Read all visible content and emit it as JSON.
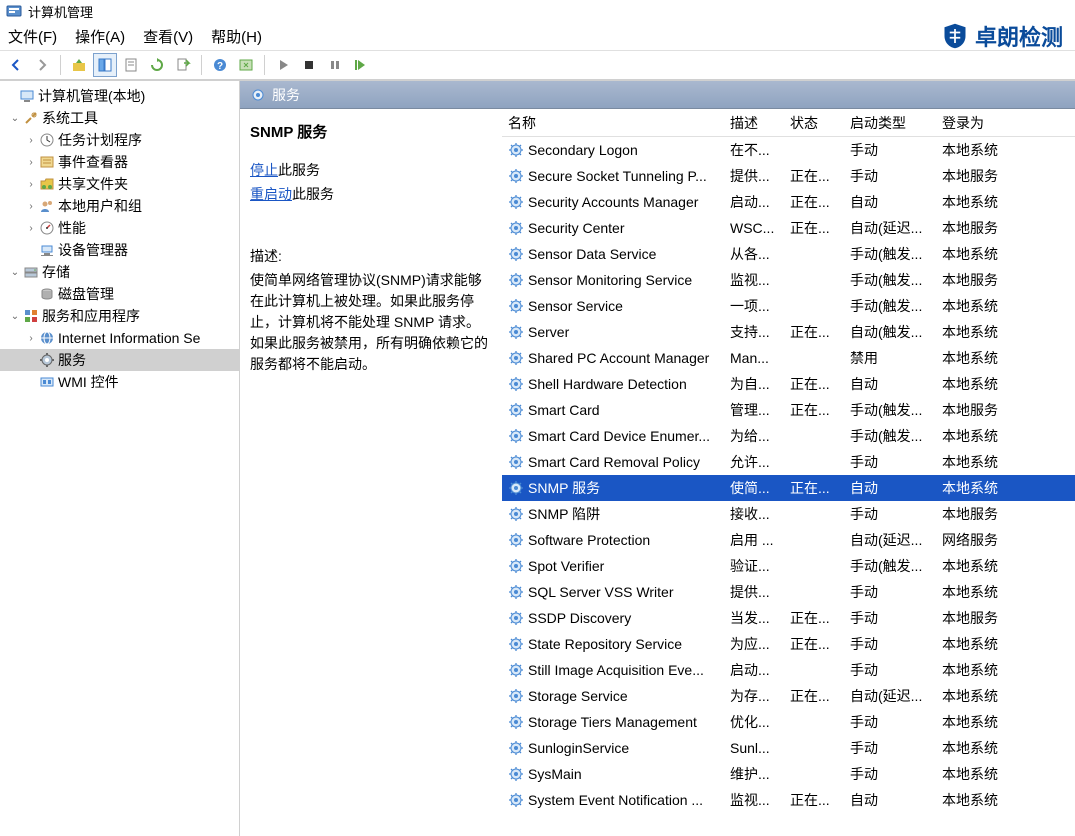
{
  "window_title": "计算机管理",
  "menu": {
    "file": "文件(F)",
    "action": "操作(A)",
    "view": "查看(V)",
    "help": "帮助(H)"
  },
  "brand": "卓朗检测",
  "tree": {
    "root": "计算机管理(本地)",
    "system_tools": "系统工具",
    "task_scheduler": "任务计划程序",
    "event_viewer": "事件查看器",
    "shared_folders": "共享文件夹",
    "local_users": "本地用户和组",
    "performance": "性能",
    "device_manager": "设备管理器",
    "storage": "存储",
    "disk_management": "磁盘管理",
    "services_apps": "服务和应用程序",
    "iis": "Internet Information Se",
    "services": "服务",
    "wmi": "WMI 控件"
  },
  "content_header": "服务",
  "detail": {
    "title": "SNMP 服务",
    "stop_link": "停止",
    "stop_suffix": "此服务",
    "restart_link": "重启动",
    "restart_suffix": "此服务",
    "desc_label": "描述:",
    "desc_text": "使简单网络管理协议(SNMP)请求能够在此计算机上被处理。如果此服务停止，计算机将不能处理 SNMP 请求。如果此服务被禁用，所有明确依赖它的服务都将不能启动。"
  },
  "columns": {
    "name": "名称",
    "desc": "描述",
    "status": "状态",
    "startup": "启动类型",
    "logon": "登录为"
  },
  "services": [
    {
      "name": "Secondary Logon",
      "desc": "在不...",
      "status": "",
      "startup": "手动",
      "logon": "本地系统"
    },
    {
      "name": "Secure Socket Tunneling P...",
      "desc": "提供...",
      "status": "正在...",
      "startup": "手动",
      "logon": "本地服务"
    },
    {
      "name": "Security Accounts Manager",
      "desc": "启动...",
      "status": "正在...",
      "startup": "自动",
      "logon": "本地系统"
    },
    {
      "name": "Security Center",
      "desc": "WSC...",
      "status": "正在...",
      "startup": "自动(延迟...",
      "logon": "本地服务"
    },
    {
      "name": "Sensor Data Service",
      "desc": "从各...",
      "status": "",
      "startup": "手动(触发...",
      "logon": "本地系统"
    },
    {
      "name": "Sensor Monitoring Service",
      "desc": "监视...",
      "status": "",
      "startup": "手动(触发...",
      "logon": "本地服务"
    },
    {
      "name": "Sensor Service",
      "desc": "一项...",
      "status": "",
      "startup": "手动(触发...",
      "logon": "本地系统"
    },
    {
      "name": "Server",
      "desc": "支持...",
      "status": "正在...",
      "startup": "自动(触发...",
      "logon": "本地系统"
    },
    {
      "name": "Shared PC Account Manager",
      "desc": "Man...",
      "status": "",
      "startup": "禁用",
      "logon": "本地系统"
    },
    {
      "name": "Shell Hardware Detection",
      "desc": "为自...",
      "status": "正在...",
      "startup": "自动",
      "logon": "本地系统"
    },
    {
      "name": "Smart Card",
      "desc": "管理...",
      "status": "正在...",
      "startup": "手动(触发...",
      "logon": "本地服务"
    },
    {
      "name": "Smart Card Device Enumer...",
      "desc": "为给...",
      "status": "",
      "startup": "手动(触发...",
      "logon": "本地系统"
    },
    {
      "name": "Smart Card Removal Policy",
      "desc": "允许...",
      "status": "",
      "startup": "手动",
      "logon": "本地系统"
    },
    {
      "name": "SNMP 服务",
      "desc": "使简...",
      "status": "正在...",
      "startup": "自动",
      "logon": "本地系统",
      "selected": true
    },
    {
      "name": "SNMP 陷阱",
      "desc": "接收...",
      "status": "",
      "startup": "手动",
      "logon": "本地服务"
    },
    {
      "name": "Software Protection",
      "desc": "启用 ...",
      "status": "",
      "startup": "自动(延迟...",
      "logon": "网络服务"
    },
    {
      "name": "Spot Verifier",
      "desc": "验证...",
      "status": "",
      "startup": "手动(触发...",
      "logon": "本地系统"
    },
    {
      "name": "SQL Server VSS Writer",
      "desc": "提供...",
      "status": "",
      "startup": "手动",
      "logon": "本地系统"
    },
    {
      "name": "SSDP Discovery",
      "desc": "当发...",
      "status": "正在...",
      "startup": "手动",
      "logon": "本地服务"
    },
    {
      "name": "State Repository Service",
      "desc": "为应...",
      "status": "正在...",
      "startup": "手动",
      "logon": "本地系统"
    },
    {
      "name": "Still Image Acquisition Eve...",
      "desc": "启动...",
      "status": "",
      "startup": "手动",
      "logon": "本地系统"
    },
    {
      "name": "Storage Service",
      "desc": "为存...",
      "status": "正在...",
      "startup": "自动(延迟...",
      "logon": "本地系统"
    },
    {
      "name": "Storage Tiers Management",
      "desc": "优化...",
      "status": "",
      "startup": "手动",
      "logon": "本地系统"
    },
    {
      "name": "SunloginService",
      "desc": "Sunl...",
      "status": "",
      "startup": "手动",
      "logon": "本地系统"
    },
    {
      "name": "SysMain",
      "desc": "维护...",
      "status": "",
      "startup": "手动",
      "logon": "本地系统"
    },
    {
      "name": "System Event Notification ...",
      "desc": "监视...",
      "status": "正在...",
      "startup": "自动",
      "logon": "本地系统"
    }
  ]
}
